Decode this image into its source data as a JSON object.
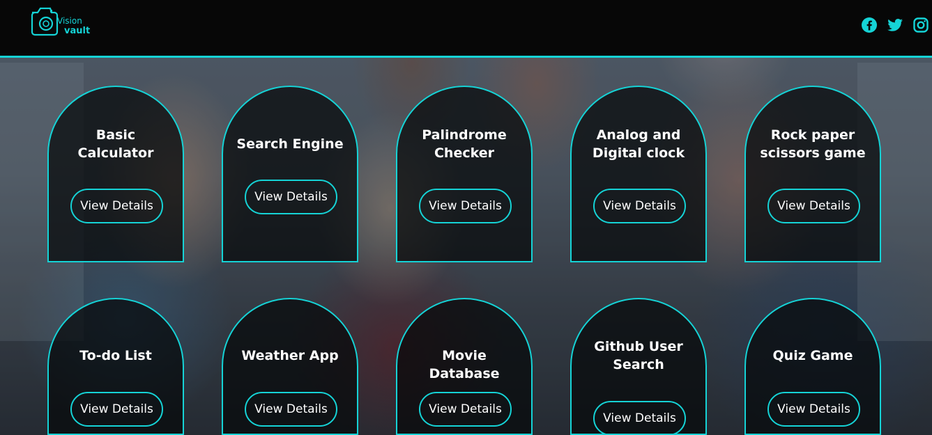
{
  "header": {
    "logo_line1": "Vision",
    "logo_line2": "vault",
    "social_icons": [
      "facebook-icon",
      "twitter-icon",
      "instagram-icon"
    ]
  },
  "theme": {
    "accent": "#15d3d6",
    "header_bg": "#070707"
  },
  "cards": {
    "button_label": "View Details",
    "row1": [
      {
        "title": "Basic Calculator"
      },
      {
        "title": "Search Engine"
      },
      {
        "title": "Palindrome Checker"
      },
      {
        "title": "Analog and Digital clock"
      },
      {
        "title": "Rock paper scissors game"
      }
    ],
    "row2": [
      {
        "title": "To-do List"
      },
      {
        "title": "Weather App"
      },
      {
        "title": "Movie Database"
      },
      {
        "title": "Github User Search"
      },
      {
        "title": "Quiz Game"
      }
    ]
  }
}
